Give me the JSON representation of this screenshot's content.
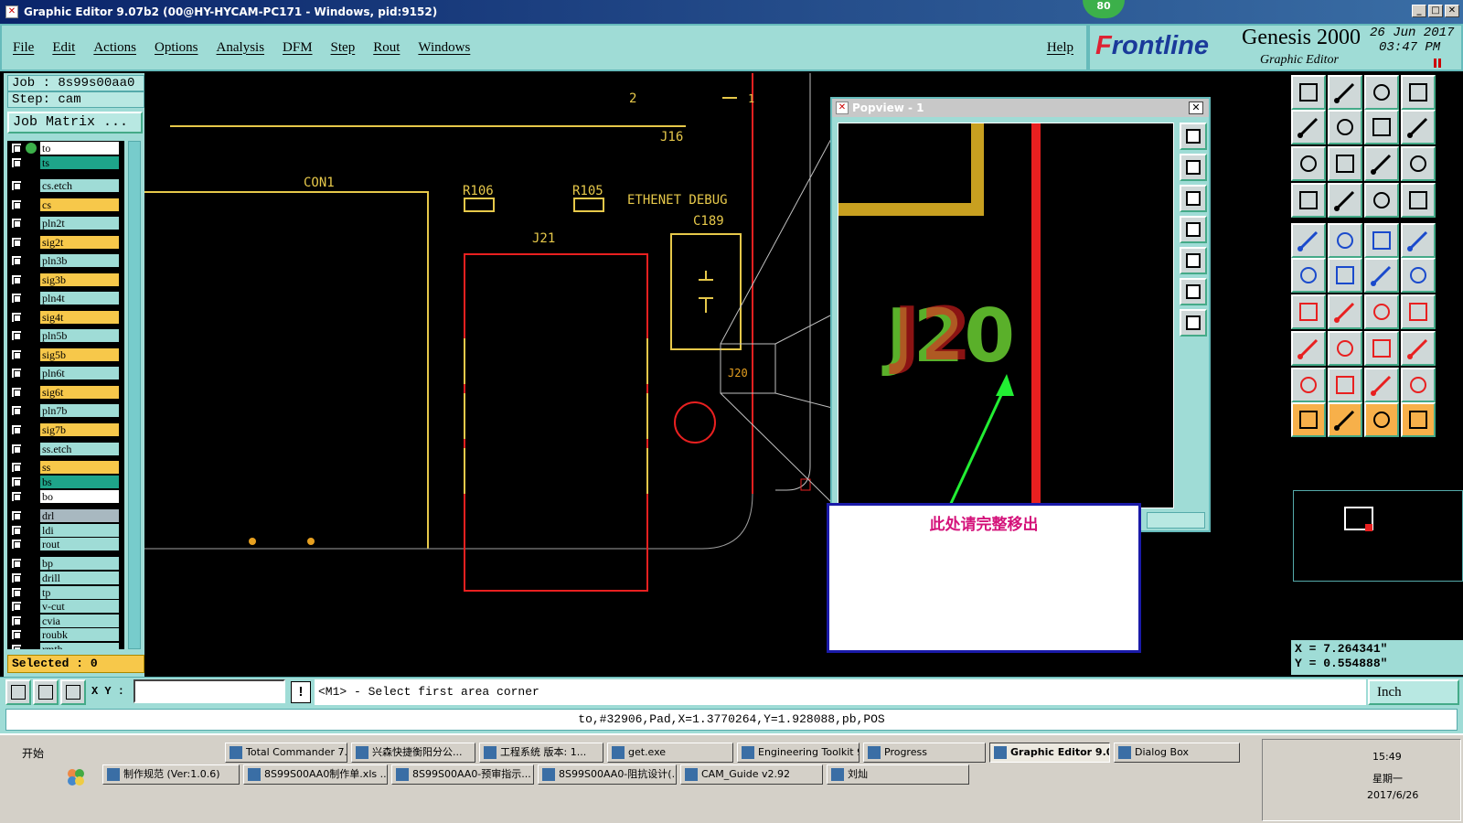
{
  "window": {
    "title": "Graphic Editor 9.07b2 (00@HY-HYCAM-PC171 - Windows, pid:9152)",
    "badge": "80"
  },
  "menu": {
    "items": [
      "File",
      "Edit",
      "Actions",
      "Options",
      "Analysis",
      "DFM",
      "Step",
      "Rout",
      "Windows"
    ],
    "help": "Help"
  },
  "brand": {
    "frontline_f": "F",
    "frontline_rest": "rontline",
    "product": "Genesis 2000",
    "subtitle": "Graphic Editor",
    "date": "26 Jun 2017",
    "time": "03:47 PM"
  },
  "job": {
    "job_label": "Job : 8s99s00aa0",
    "step_label": "Step: cam",
    "matrix_button": "Job Matrix ..."
  },
  "layers": [
    {
      "name": "to",
      "color": "#ffffff",
      "active": true
    },
    {
      "name": "ts",
      "color": "#1ea58a"
    },
    {
      "name": "cs.etch",
      "color": "#9fdcd6"
    },
    {
      "name": "cs",
      "color": "#f7c84a"
    },
    {
      "name": "pln2t",
      "color": "#9fdcd6"
    },
    {
      "name": "sig2t",
      "color": "#f7c84a"
    },
    {
      "name": "pln3b",
      "color": "#9fdcd6"
    },
    {
      "name": "sig3b",
      "color": "#f7c84a"
    },
    {
      "name": "pln4t",
      "color": "#9fdcd6"
    },
    {
      "name": "sig4t",
      "color": "#f7c84a"
    },
    {
      "name": "pln5b",
      "color": "#9fdcd6"
    },
    {
      "name": "sig5b",
      "color": "#f7c84a"
    },
    {
      "name": "pln6t",
      "color": "#9fdcd6"
    },
    {
      "name": "sig6t",
      "color": "#f7c84a"
    },
    {
      "name": "pln7b",
      "color": "#9fdcd6"
    },
    {
      "name": "sig7b",
      "color": "#f7c84a"
    },
    {
      "name": "ss.etch",
      "color": "#9fdcd6"
    },
    {
      "name": "ss",
      "color": "#f7c84a"
    },
    {
      "name": "bs",
      "color": "#1ea58a"
    },
    {
      "name": "bo",
      "color": "#ffffff"
    },
    {
      "name": "drl",
      "color": "#a8b8c0"
    },
    {
      "name": "ldi",
      "color": "#9fdcd6"
    },
    {
      "name": "rout",
      "color": "#9fdcd6"
    },
    {
      "name": "bp",
      "color": "#9fdcd6"
    },
    {
      "name": "drill",
      "color": "#9fdcd6"
    },
    {
      "name": "tp",
      "color": "#9fdcd6"
    },
    {
      "name": "v-cut",
      "color": "#9fdcd6"
    },
    {
      "name": "cvia",
      "color": "#9fdcd6"
    },
    {
      "name": "roubk",
      "color": "#9fdcd6"
    },
    {
      "name": "rmth",
      "color": "#9fdcd6"
    }
  ],
  "selected": "Selected : 0",
  "canvas": {
    "labels": {
      "con1": "CON1",
      "r106": "R106",
      "r105": "R105",
      "ethernet": "ETHENET DEBUG",
      "c189": "C189",
      "j21": "J21",
      "j16": "J16",
      "n2": "2",
      "n1": "1",
      "j20": "J20"
    },
    "colors": {
      "outline": "#e6c84a",
      "copper": "#e82020",
      "silk": "#ffcc33",
      "green": "#5ab02a"
    }
  },
  "popview": {
    "title": "Popview - 1",
    "label": "J20"
  },
  "note": {
    "text": "此处请完整移出"
  },
  "coords": {
    "x": "X = 7.264341\"",
    "y": "Y = 0.554888\""
  },
  "command": {
    "xy_label": "X Y :",
    "xy_value": "",
    "prompt": "<M1> - Select first area corner",
    "unit": "Inch"
  },
  "status": "to,#32906,Pad,X=1.3770264,Y=1.928088,pb,POS",
  "taskbar": {
    "start": "开始",
    "row1": [
      "Total Commander 7....",
      "兴森快捷衡阳分公...",
      "工程系统  版本: 1...",
      "get.exe",
      "Engineering Toolkit 9...",
      "Progress",
      "Graphic Editor 9.0...",
      "Dialog Box"
    ],
    "row2": [
      "制作规范 (Ver:1.0.6)",
      "8S99S00AA0制作单.xls ...",
      "8S99S00AA0-预审指示...",
      "8S99S00AA0-阻抗设计(...",
      "CAM_Guide v2.92",
      "刘灿"
    ],
    "time": "15:49",
    "day": "星期一",
    "date": "2017/6/26"
  }
}
